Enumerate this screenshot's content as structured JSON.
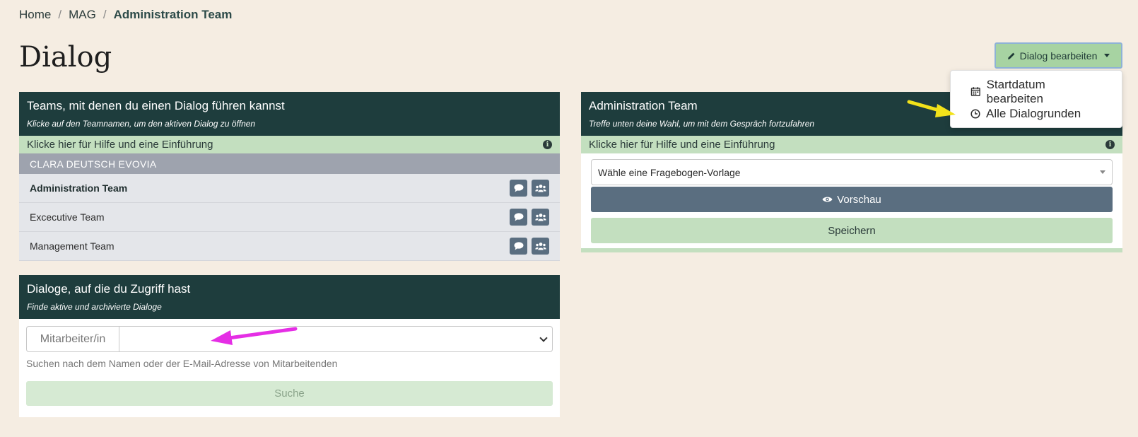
{
  "breadcrumb": {
    "home": "Home",
    "mag": "MAG",
    "current": "Administration Team"
  },
  "page": {
    "title": "Dialog"
  },
  "edit_button": {
    "label": "Dialog bearbeiten"
  },
  "dropdown": {
    "items": [
      {
        "label": "Startdatum bearbeiten",
        "icon": "calendar-icon"
      },
      {
        "label": "Alle Dialogrunden",
        "icon": "clock-icon"
      }
    ]
  },
  "teams_panel": {
    "title": "Teams, mit denen du einen Dialog führen kannst",
    "subtitle": "Klicke auf den Teamnamen, um den aktiven Dialog zu öffnen",
    "help": "Klicke hier für Hilfe und eine Einführung",
    "group": "CLARA DEUTSCH EVOVIA",
    "teams": [
      {
        "name": "Administration Team"
      },
      {
        "name": "Excecutive Team"
      },
      {
        "name": "Management Team"
      }
    ]
  },
  "access_panel": {
    "title": "Dialoge, auf die du Zugriff hast",
    "subtitle": "Finde aktive und archivierte Dialoge",
    "addon": "Mitarbeiter/in",
    "help_text": "Suchen nach dem Namen oder der E-Mail-Adresse von Mitarbeitenden",
    "search_button": "Suche"
  },
  "admin_panel": {
    "title": "Administration Team",
    "subtitle": "Treffe unten deine Wahl, um mit dem Gespräch fortzufahren",
    "help": "Klicke hier für Hilfe und eine Einführung",
    "select_placeholder": "Wähle eine Fragebogen-Vorlage",
    "preview_button": "Vorschau",
    "save_button": "Speichern"
  },
  "colors": {
    "header_bg": "#1e3d3d",
    "accent_green": "#c3dfbf",
    "button_slate": "#5a6e80",
    "page_bg": "#f5ede2",
    "arrow_yellow": "#f2e21a",
    "arrow_magenta": "#e52ee5"
  }
}
